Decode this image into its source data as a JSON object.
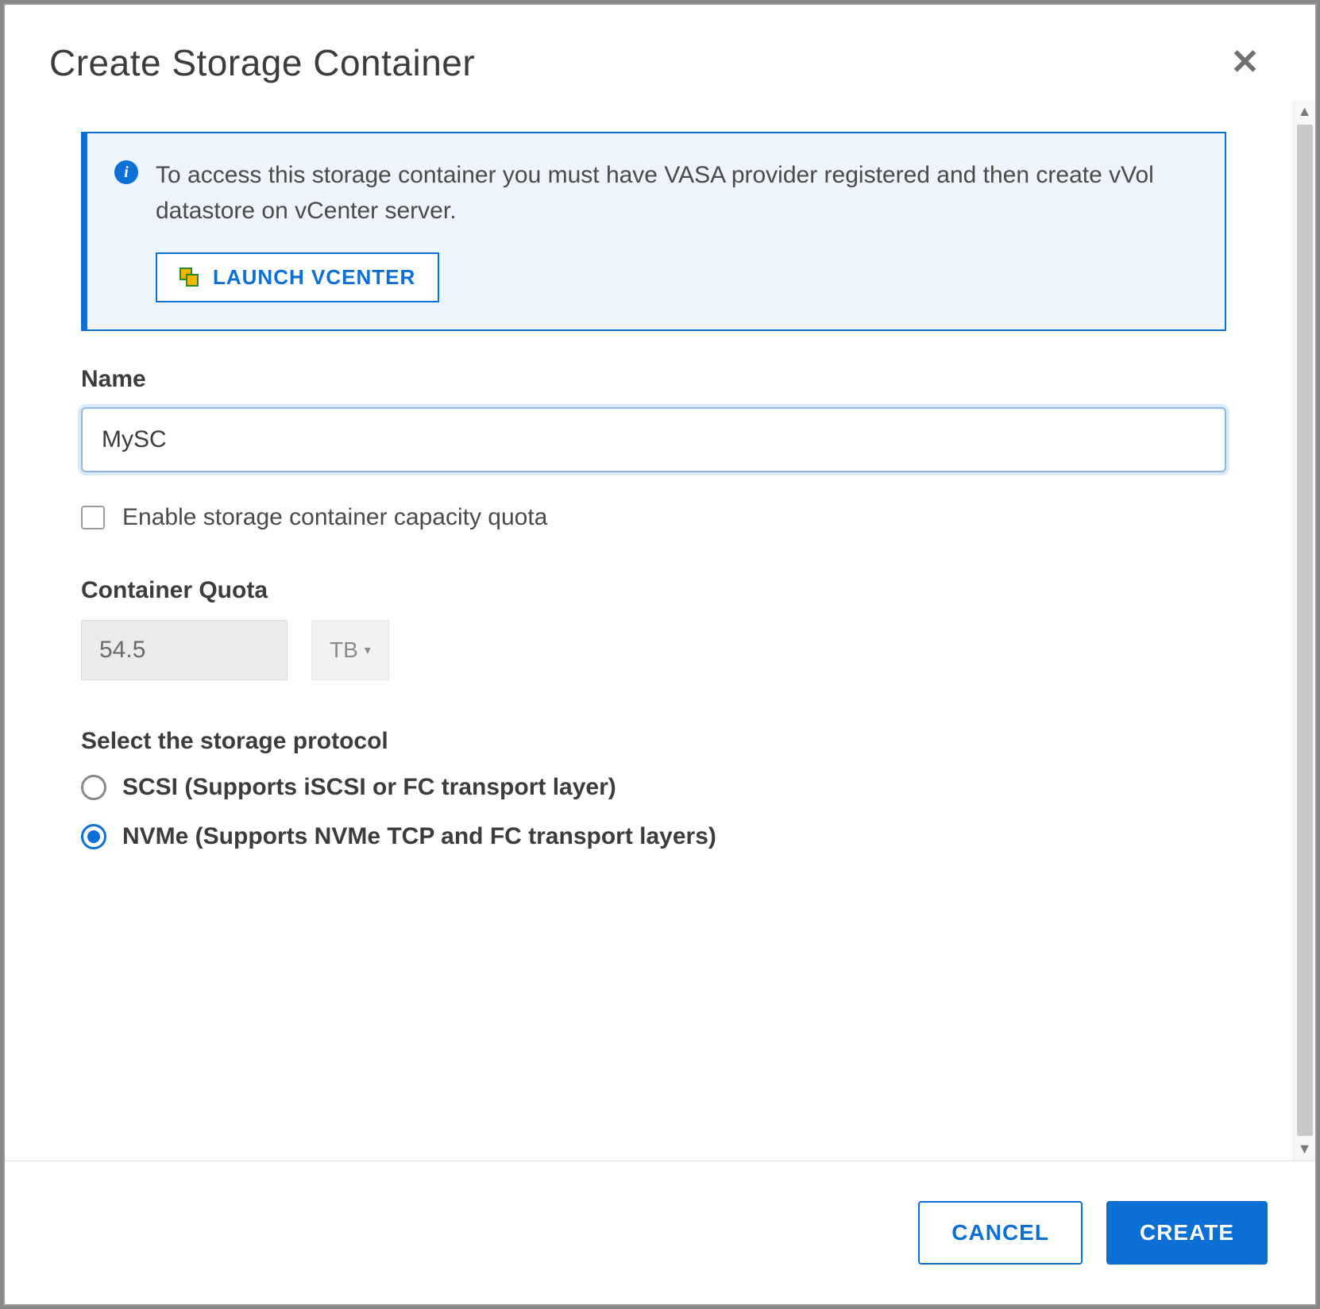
{
  "dialog": {
    "title": "Create Storage Container",
    "info_text": "To access this storage container you must have VASA provider registered and then create vVol datastore on vCenter server.",
    "launch_label": "LAUNCH VCENTER"
  },
  "fields": {
    "name_label": "Name",
    "name_value": "MySC",
    "enable_quota_label": "Enable storage container capacity quota",
    "enable_quota_checked": false,
    "quota_label": "Container Quota",
    "quota_value": "54.5",
    "quota_unit": "TB"
  },
  "protocol": {
    "label": "Select the storage protocol",
    "options": [
      {
        "id": "scsi",
        "label": "SCSI (Supports iSCSI or FC transport layer)",
        "selected": false
      },
      {
        "id": "nvme",
        "label": "NVMe (Supports NVMe TCP and FC transport layers)",
        "selected": true
      }
    ]
  },
  "footer": {
    "cancel": "CANCEL",
    "create": "CREATE"
  }
}
